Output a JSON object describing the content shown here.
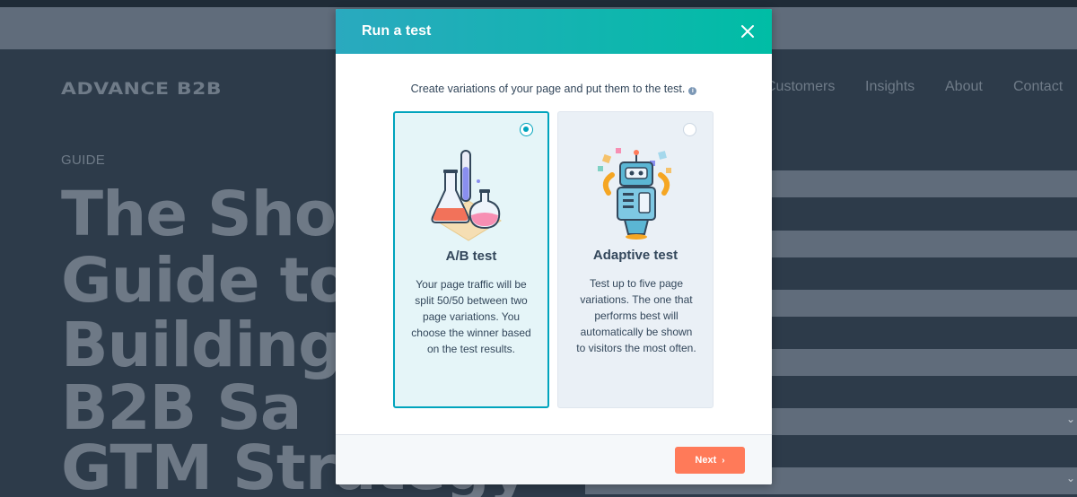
{
  "background": {
    "logo": "ADVANCE B2B",
    "nav": [
      "Customers",
      "Insights",
      "About",
      "Contact"
    ],
    "eyebrow": "GUIDE",
    "headline_lines": [
      "The Sho",
      "Guide to",
      "Building",
      "B2B Sa",
      "GTM Strategy"
    ]
  },
  "modal": {
    "title": "Run a test",
    "intro": "Create variations of your page and put them to the test.",
    "options": [
      {
        "title": "A/B test",
        "description": "Your page traffic will be split 50/50 between two page variations. You choose the winner based on the test results.",
        "selected": true
      },
      {
        "title": "Adaptive test",
        "description": "Test up to five page variations. The one that performs best will automatically be shown to visitors the most often.",
        "selected": false
      }
    ],
    "next_label": "Next"
  },
  "colors": {
    "header_gradient_start": "#2aa9bf",
    "header_gradient_end": "#00bda5",
    "accent": "#00a4bd",
    "primary_button": "#ff7a59",
    "text": "#33475b",
    "backdrop": "#2d3b4a"
  },
  "icons": {
    "close": "close-icon",
    "info": "info-icon",
    "next": "chevron-right-icon",
    "ab_illustration": "lab-flasks-illustration",
    "adaptive_illustration": "robot-illustration"
  }
}
